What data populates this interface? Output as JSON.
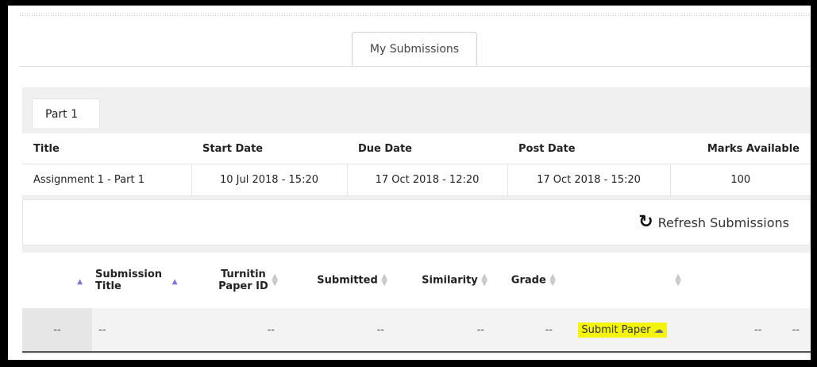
{
  "tabs": {
    "my_submissions": "My Submissions"
  },
  "part_tab": {
    "label": "Part 1"
  },
  "assignment_table": {
    "headers": [
      "Title",
      "Start Date",
      "Due Date",
      "Post Date",
      "Marks Available"
    ],
    "row": [
      "Assignment 1 - Part 1",
      "10 Jul 2018 - 15:20",
      "17 Oct 2018 - 12:20",
      "17 Oct 2018 - 15:20",
      "100"
    ]
  },
  "refresh": {
    "label": "Refresh Submissions",
    "icon": "refresh-icon"
  },
  "submissions_table": {
    "headers": {
      "title_line1": "Submission",
      "title_line2": "Title",
      "paper_line1": "Turnitin",
      "paper_line2": "Paper ID",
      "submitted": "Submitted",
      "similarity": "Similarity",
      "grade": "Grade"
    },
    "row": {
      "c0": "--",
      "c1": "--",
      "paper_id": "--",
      "submitted": "--",
      "similarity": "--",
      "grade": "--",
      "submit_label": "Submit Paper",
      "c7": "--",
      "c8": "--"
    }
  },
  "colors": {
    "highlight": "#f4f40a",
    "sort_active": "#7a7ad6"
  }
}
